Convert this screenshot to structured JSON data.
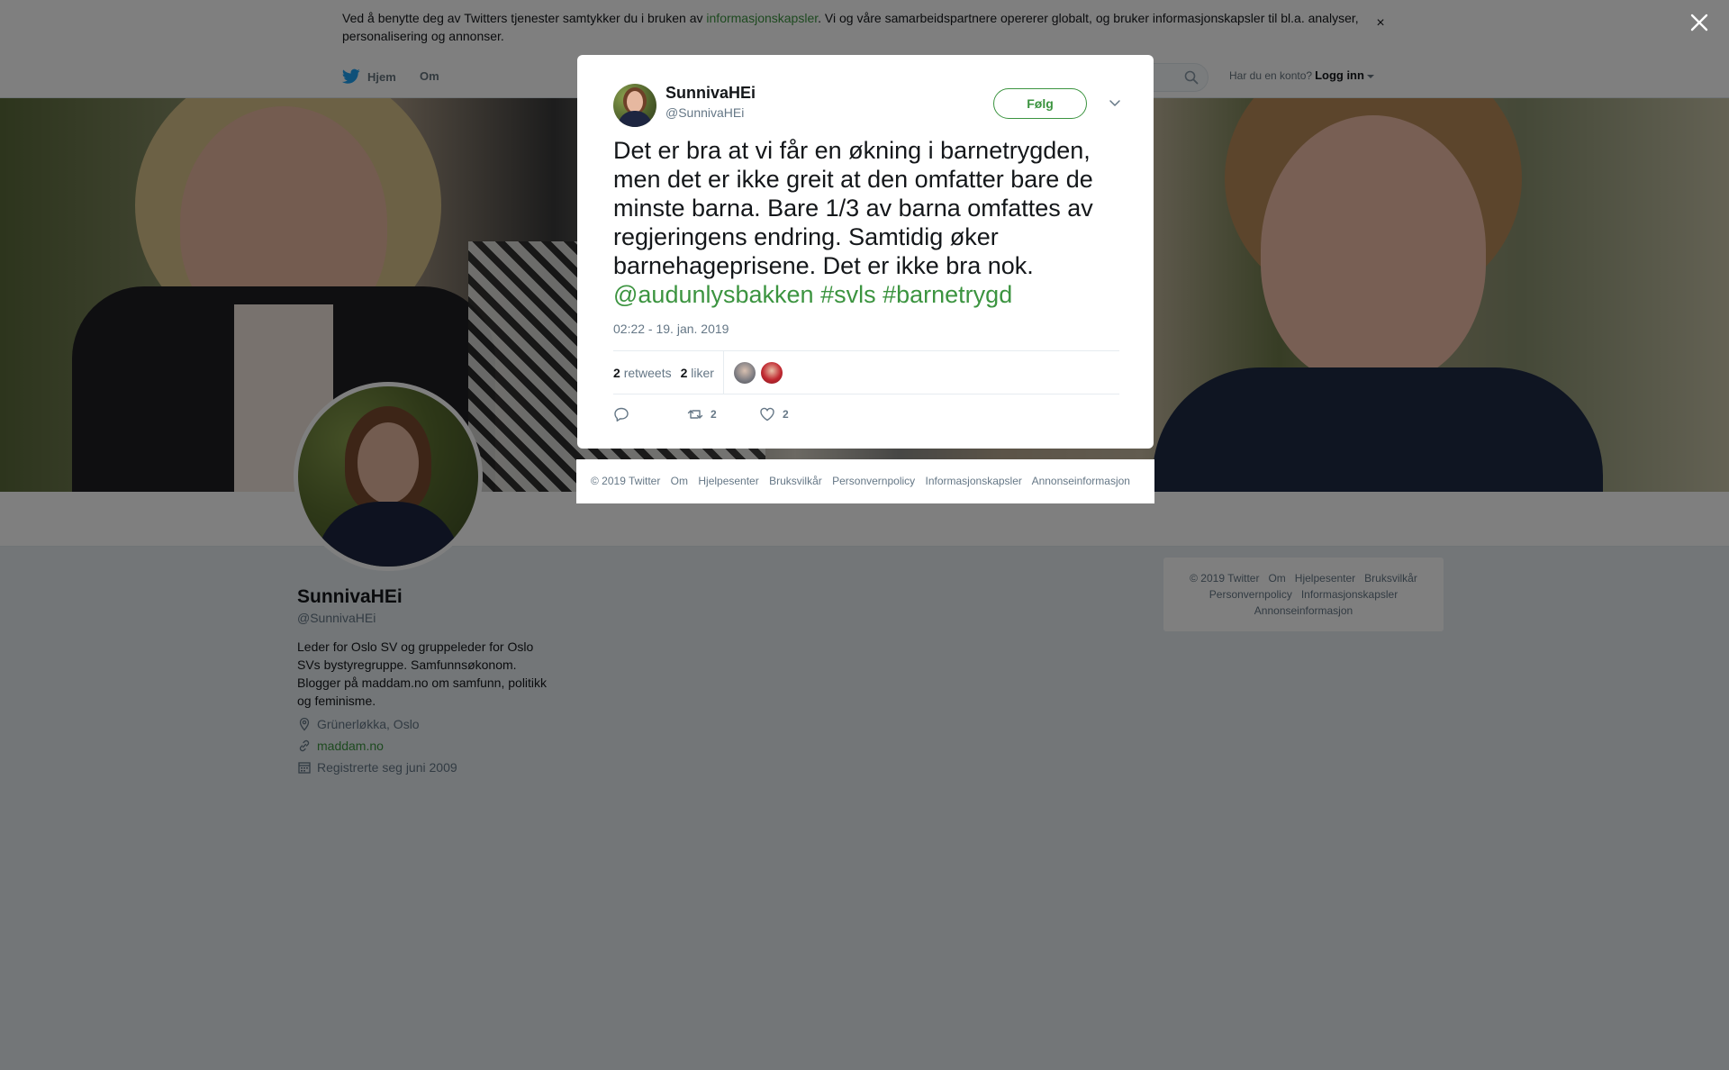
{
  "cookie": {
    "text_before": "Ved å benytte deg av Twitters tjenester samtykker du i bruken av ",
    "link": "informasjonskapsler",
    "text_after": ". Vi og våre samarbeidspartnere opererer globalt, og bruker informasjonskapsler til bl.a. analyser, personalisering og annonser.",
    "close": "×"
  },
  "nav": {
    "home": "Hjem",
    "about": "Om",
    "have_account": "Har du en konto?",
    "login": "Logg inn"
  },
  "profile": {
    "name": "SunnivaHEi",
    "handle": "@SunnivaHEi",
    "bio": "Leder for Oslo SV og gruppeleder for Oslo SVs bystyregruppe. Samfunnsøkonom. Blogger på maddam.no om samfunn, politikk og feminisme.",
    "location": "Grünerløkka, Oslo",
    "website": "maddam.no",
    "joined": "Registrerte seg juni 2009"
  },
  "tweet": {
    "name": "SunnivaHEi",
    "handle": "@SunnivaHEi",
    "follow_label": "Følg",
    "text": "Det er bra at vi får en økning i barnetrygden, men det er ikke greit at den omfatter bare de minste barna. Bare 1/3 av barna omfattes av regjeringens endring. Samtidig øker barnehageprisene. Det er ikke bra nok.",
    "mention": "@audunlysbakken",
    "hashtag1": "#svls",
    "hashtag2": "#barnetrygd",
    "timestamp": "02:22 - 19. jan. 2019",
    "retweets_count": "2",
    "retweets_label": "retweets",
    "likes_count": "2",
    "likes_label": "liker",
    "action_retweet_count": "2",
    "action_like_count": "2"
  },
  "footer": {
    "copyright": "© 2019 Twitter",
    "about": "Om",
    "help": "Hjelpesenter",
    "terms": "Bruksvilkår",
    "privacy": "Personvernpolicy",
    "cookies": "Informasjonskapsler",
    "ads": "Annonseinformasjon"
  },
  "colors": {
    "accent": "#3c9440",
    "text": "#14171a",
    "muted": "#657786",
    "background": "#e6ecf0",
    "overlay": "rgba(0,0,0,0.5)"
  },
  "icons": [
    "twitter-bird-icon",
    "search-icon",
    "close-icon",
    "chevron-down-icon",
    "location-icon",
    "link-icon",
    "calendar-icon",
    "reply-icon",
    "retweet-icon",
    "heart-icon"
  ]
}
